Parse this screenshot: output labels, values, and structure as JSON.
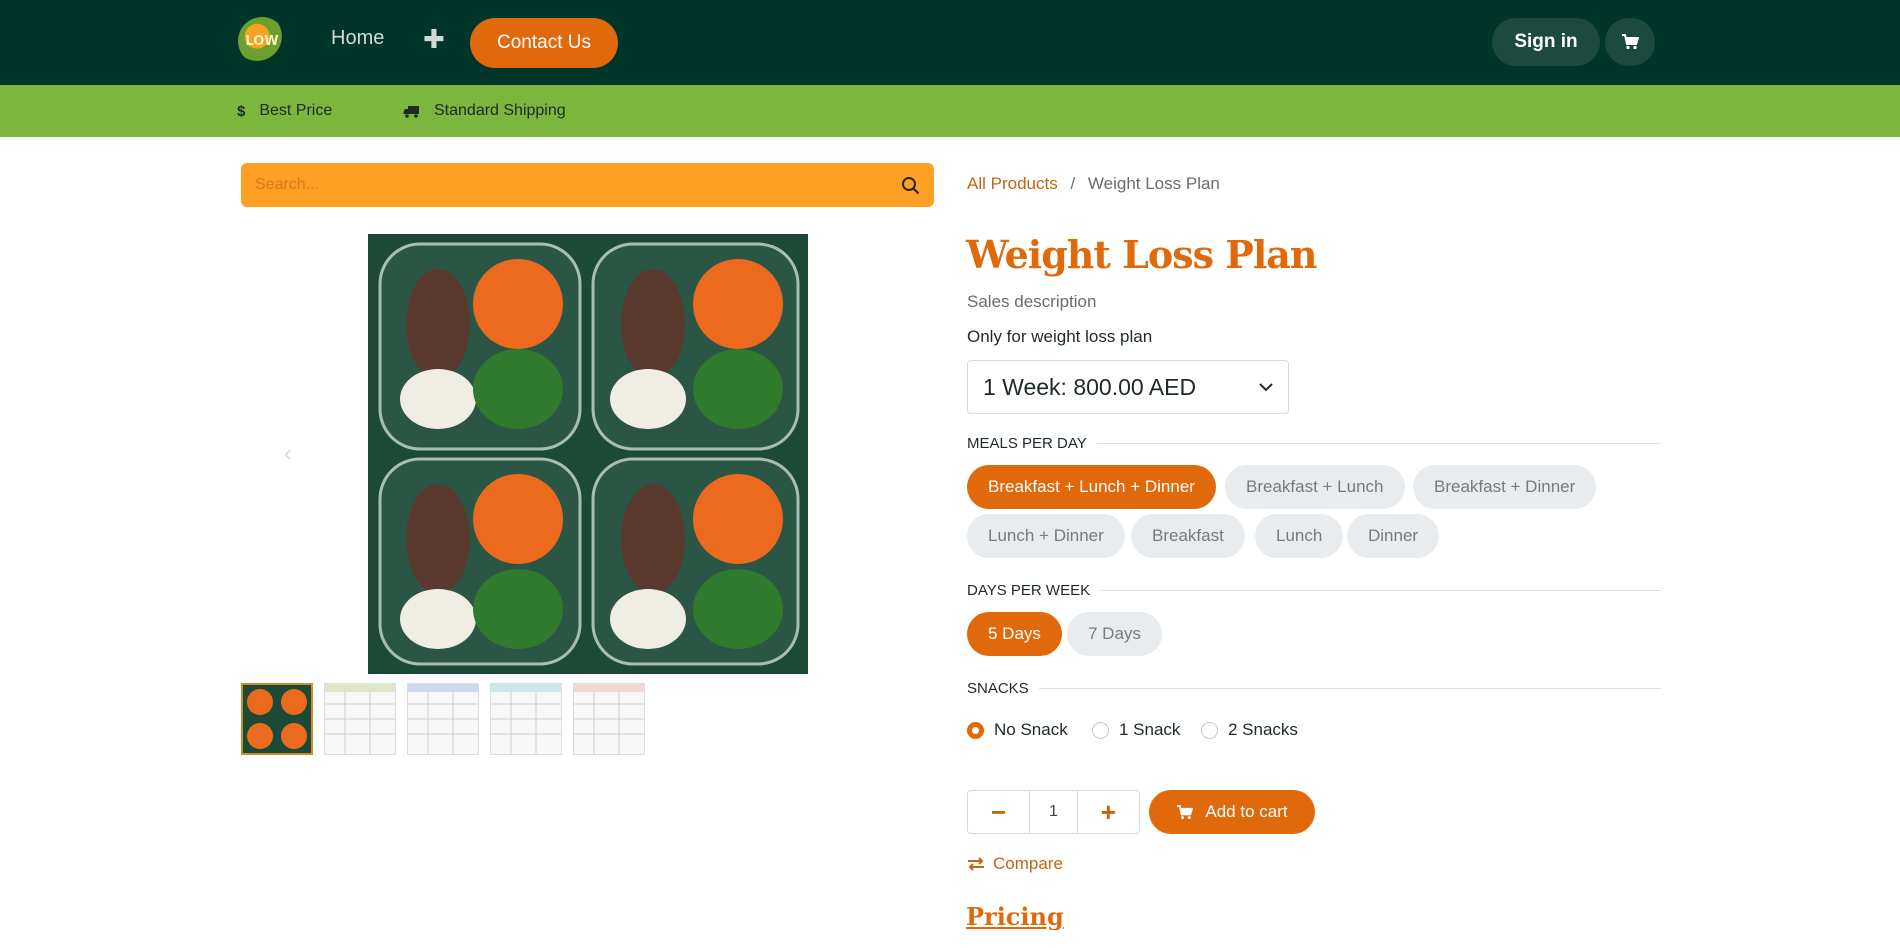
{
  "header": {
    "logo_text": "LOW",
    "nav_home": "Home",
    "nav_plus": "✚",
    "contact_label": "Contact Us",
    "signin_label": "Sign in",
    "cart_icon": "cart-icon"
  },
  "perks": {
    "best_price_icon": "$",
    "best_price": "Best Price",
    "shipping_icon": "truck-icon",
    "shipping": "Standard Shipping"
  },
  "search": {
    "placeholder": "Search...",
    "icon": "search-icon"
  },
  "breadcrumb": {
    "parent": "All Products",
    "separator": "/",
    "current": "Weight Loss Plan"
  },
  "product": {
    "title": "Weight Loss Plan",
    "sales_description": "Sales description",
    "note": "Only for weight loss plan",
    "selected_variant": "1 Week: 800.00 AED"
  },
  "meals": {
    "label": "MEALS PER DAY",
    "options": [
      "Breakfast + Lunch + Dinner",
      "Breakfast + Lunch",
      "Breakfast + Dinner",
      "Lunch + Dinner",
      "Breakfast",
      "Lunch",
      "Dinner"
    ],
    "selected": "Breakfast + Lunch + Dinner"
  },
  "days": {
    "label": "DAYS PER WEEK",
    "options": [
      "5 Days",
      "7 Days"
    ],
    "selected": "5 Days"
  },
  "snacks": {
    "label": "SNACKS",
    "options": [
      "No Snack",
      "1 Snack",
      "2 Snacks"
    ],
    "selected": "No Snack"
  },
  "cart": {
    "quantity": "1",
    "minus": "−",
    "plus": "+",
    "add_label": "Add to cart"
  },
  "compare_label": "Compare",
  "pricing_label": "Pricing",
  "colors": {
    "header_bg": "#00352a",
    "accent": "#e06a0b",
    "perk_bar": "#7db63c",
    "search_bg": "#ffa024"
  }
}
